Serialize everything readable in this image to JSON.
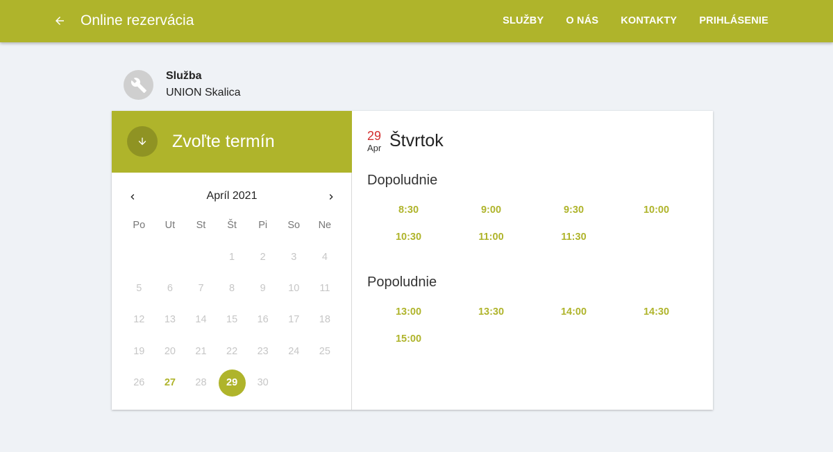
{
  "header": {
    "title": "Online rezervácia",
    "nav": [
      "SLUŽBY",
      "O NÁS",
      "KONTAKTY",
      "PRIHLÁSENIE"
    ]
  },
  "service": {
    "label": "Služba",
    "name": "UNION Skalica"
  },
  "picker": {
    "title": "Zvoľte termín",
    "month_label": "Apríl 2021",
    "weekdays": [
      "Po",
      "Ut",
      "St",
      "Št",
      "Pi",
      "So",
      "Ne"
    ],
    "leading_blanks": 3,
    "days": [
      {
        "n": "1",
        "state": "disabled"
      },
      {
        "n": "2",
        "state": "disabled"
      },
      {
        "n": "3",
        "state": "disabled"
      },
      {
        "n": "4",
        "state": "disabled"
      },
      {
        "n": "5",
        "state": "disabled"
      },
      {
        "n": "6",
        "state": "disabled"
      },
      {
        "n": "7",
        "state": "disabled"
      },
      {
        "n": "8",
        "state": "disabled"
      },
      {
        "n": "9",
        "state": "disabled"
      },
      {
        "n": "10",
        "state": "disabled"
      },
      {
        "n": "11",
        "state": "disabled"
      },
      {
        "n": "12",
        "state": "disabled"
      },
      {
        "n": "13",
        "state": "disabled"
      },
      {
        "n": "14",
        "state": "disabled"
      },
      {
        "n": "15",
        "state": "disabled"
      },
      {
        "n": "16",
        "state": "disabled"
      },
      {
        "n": "17",
        "state": "disabled"
      },
      {
        "n": "18",
        "state": "disabled"
      },
      {
        "n": "19",
        "state": "disabled"
      },
      {
        "n": "20",
        "state": "disabled"
      },
      {
        "n": "21",
        "state": "disabled"
      },
      {
        "n": "22",
        "state": "disabled"
      },
      {
        "n": "23",
        "state": "disabled"
      },
      {
        "n": "24",
        "state": "disabled"
      },
      {
        "n": "25",
        "state": "disabled"
      },
      {
        "n": "26",
        "state": "disabled"
      },
      {
        "n": "27",
        "state": "available"
      },
      {
        "n": "28",
        "state": "disabled"
      },
      {
        "n": "29",
        "state": "selected"
      },
      {
        "n": "30",
        "state": "disabled"
      }
    ]
  },
  "selected_date": {
    "day": "29",
    "month": "Apr",
    "weekday": "Štvrtok"
  },
  "sections": [
    {
      "title": "Dopoludnie",
      "slots": [
        "8:30",
        "9:00",
        "9:30",
        "10:00",
        "10:30",
        "11:00",
        "11:30"
      ]
    },
    {
      "title": "Popoludnie",
      "slots": [
        "13:00",
        "13:30",
        "14:00",
        "14:30",
        "15:00"
      ]
    }
  ],
  "colors": {
    "accent": "#afb42b",
    "accent_dark": "#8f9323",
    "date_red": "#d32f2f"
  },
  "icons": {
    "back": "arrow-left-icon",
    "service": "wrench-icon",
    "picker": "arrow-down-icon",
    "prev": "chevron-left-icon",
    "next": "chevron-right-icon"
  }
}
